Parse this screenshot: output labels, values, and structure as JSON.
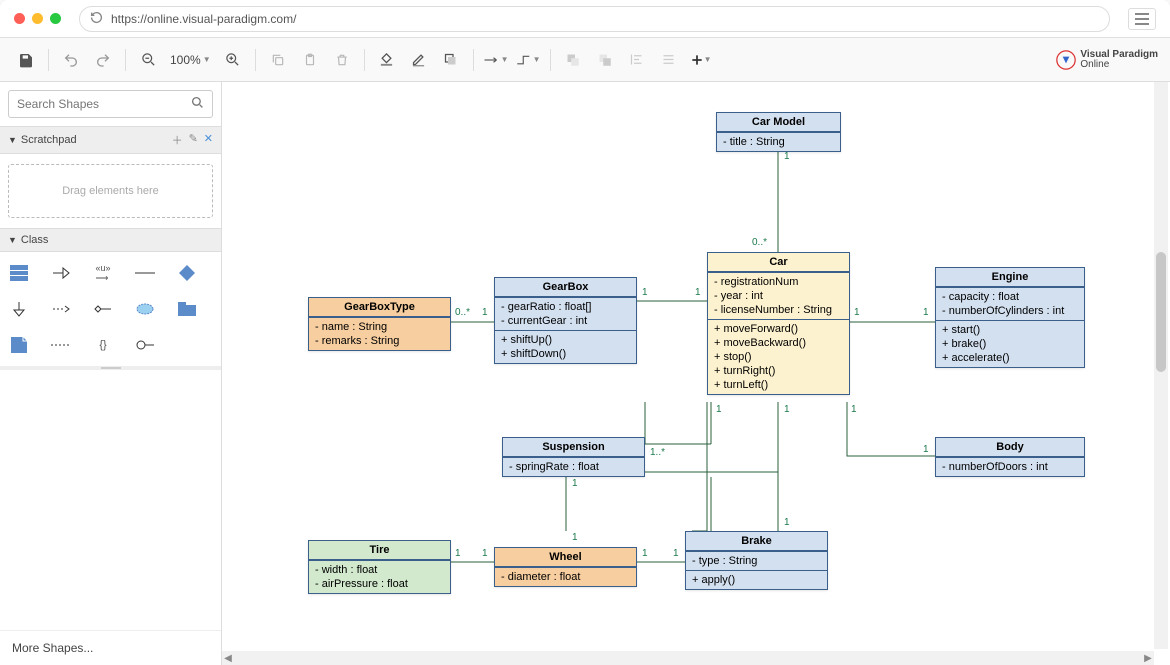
{
  "browser": {
    "url": "https://online.visual-paradigm.com/"
  },
  "toolbar": {
    "zoom": "100%"
  },
  "sidebar": {
    "search_placeholder": "Search Shapes",
    "scratchpad_title": "Scratchpad",
    "scratchpad_drop": "Drag elements here",
    "class_title": "Class",
    "more_shapes": "More Shapes..."
  },
  "logo": {
    "line1": "Visual Paradigm",
    "line2": "Online"
  },
  "classes": {
    "carModel": {
      "name": "Car Model",
      "attrs": [
        "- title : String"
      ]
    },
    "car": {
      "name": "Car",
      "attrs": [
        "- registrationNum",
        "- year : int",
        "- licenseNumber : String"
      ],
      "ops": [
        "+ moveForward()",
        "+ moveBackward()",
        "+ stop()",
        "+ turnRight()",
        "+ turnLeft()"
      ]
    },
    "engine": {
      "name": "Engine",
      "attrs": [
        "- capacity : float",
        "- numberOfCylinders : int"
      ],
      "ops": [
        "+ start()",
        "+ brake()",
        "+ accelerate()"
      ]
    },
    "gearBox": {
      "name": "GearBox",
      "attrs": [
        "- gearRatio : float[]",
        "- currentGear : int"
      ],
      "ops": [
        "+ shiftUp()",
        "+ shiftDown()"
      ]
    },
    "gearBoxType": {
      "name": "GearBoxType",
      "attrs": [
        "- name : String",
        "- remarks : String"
      ]
    },
    "suspension": {
      "name": "Suspension",
      "attrs": [
        "- springRate : float"
      ]
    },
    "body": {
      "name": "Body",
      "attrs": [
        "- numberOfDoors : int"
      ]
    },
    "brake": {
      "name": "Brake",
      "attrs": [
        "- type : String"
      ],
      "ops": [
        "+ apply()"
      ]
    },
    "wheel": {
      "name": "Wheel",
      "attrs": [
        "- diameter : float"
      ]
    },
    "tire": {
      "name": "Tire",
      "attrs": [
        "- width : float",
        "- airPressure : float"
      ]
    }
  },
  "mult": {
    "carModel_car_top": "1",
    "carModel_car_bottom": "0..*",
    "gearbox_gearboxtype_left": "0..*",
    "gearbox_gearboxtype_right": "1",
    "gearbox_car_left": "1",
    "gearbox_car_right": "1",
    "car_engine_left": "1",
    "car_engine_right": "1",
    "car_susp_top": "1",
    "car_susp_right": "1..*",
    "car_body_top": "1",
    "car_body_right": "1",
    "car_brake_top": "1",
    "car_brake_bottom": "1",
    "susp_wheel_top": "1",
    "susp_wheel_bottom": "1",
    "wheel_brake_left": "1",
    "wheel_brake_right": "1",
    "wheel_tire_left": "1",
    "wheel_tire_right": "1"
  }
}
